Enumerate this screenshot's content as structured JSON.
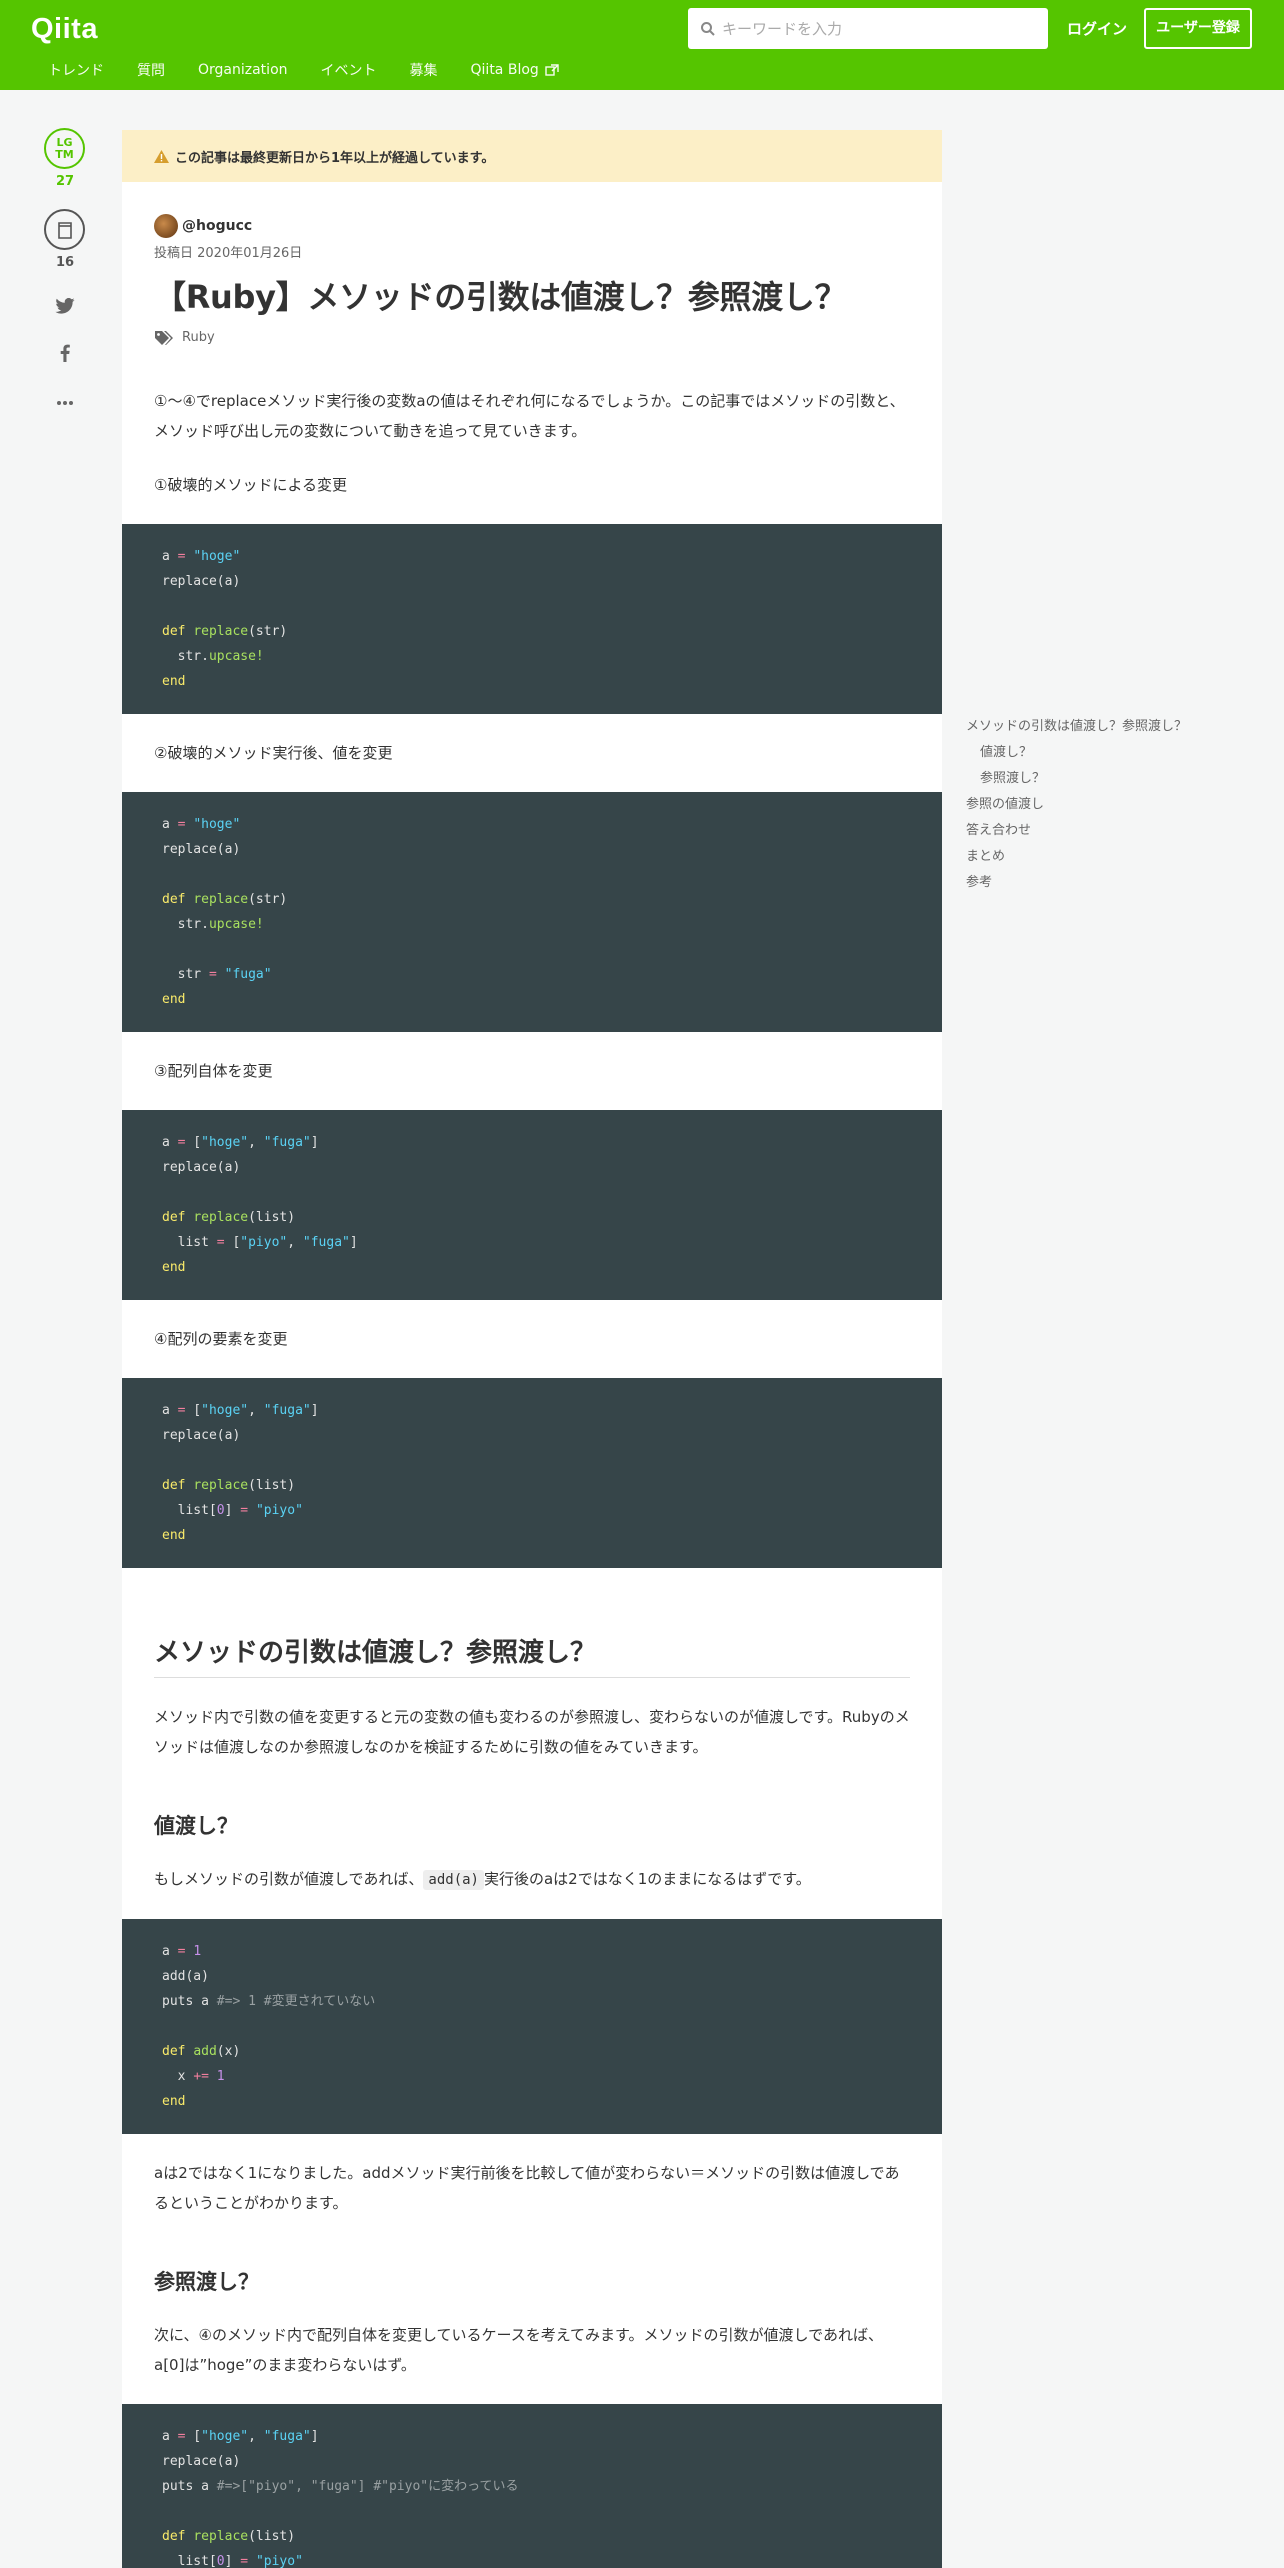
{
  "header": {
    "logo": "Qiita",
    "search_placeholder": "キーワードを入力",
    "login": "ログイン",
    "signup": "ユーザー登録",
    "nav": [
      "トレンド",
      "質問",
      "Organization",
      "イベント",
      "募集",
      "Qiita Blog"
    ]
  },
  "rail": {
    "lgtm_label_top": "LG",
    "lgtm_label_bottom": "TM",
    "lgtm_count": "27",
    "stock_count": "16"
  },
  "article": {
    "alert": "この記事は最終更新日から1年以上が経過しています。",
    "author": "@hogucc",
    "posted": "投稿日 2020年01月26日",
    "title": "【Ruby】メソッドの引数は値渡し？参照渡し？",
    "tag": "Ruby",
    "intro": "①〜④でreplaceメソッド実行後の変数aの値はそれぞれ何になるでしょうか。この記事ではメソッドの引数と、メソッド呼び出し元の変数について動きを追って見ていきます。",
    "case1": "①破壊的メソッドによる変更",
    "case2": "②破壊的メソッド実行後、値を変更",
    "case3": "③配列自体を変更",
    "case4": "④配列の要素を変更",
    "h2": "メソッドの引数は値渡し？参照渡し？",
    "h2_para": "メソッド内で引数の値を変更すると元の変数の値も変わるのが参照渡し、変わらないのが値渡しです。Rubyのメソッドは値渡しなのか参照渡しなのかを検証するために引数の値をみていきます。",
    "h3_value": "値渡し？",
    "value_para_before": "もしメソッドの引数が値渡しであれば、",
    "value_para_code": "add(a)",
    "value_para_after": "実行後のaは2ではなく1のままになるはずです。",
    "value_result": "aは2ではなく1になりました。addメソッド実行前後を比較して値が変わらない＝メソッドの引数は値渡しであるということがわかります。",
    "h3_ref": "参照渡し？",
    "ref_para": "次に、④のメソッド内で配列自体を変更しているケースを考えてみます。メソッドの引数が値渡しであれば、a[0]は”hoge”のまま変わらないはず。"
  },
  "toc": [
    {
      "label": "メソッドの引数は値渡し？参照渡し？",
      "sub": false
    },
    {
      "label": "値渡し？",
      "sub": true
    },
    {
      "label": "参照渡し？",
      "sub": true
    },
    {
      "label": "参照の値渡し",
      "sub": false
    },
    {
      "label": "答え合わせ",
      "sub": false
    },
    {
      "label": "まとめ",
      "sub": false
    },
    {
      "label": "参考",
      "sub": false
    }
  ]
}
